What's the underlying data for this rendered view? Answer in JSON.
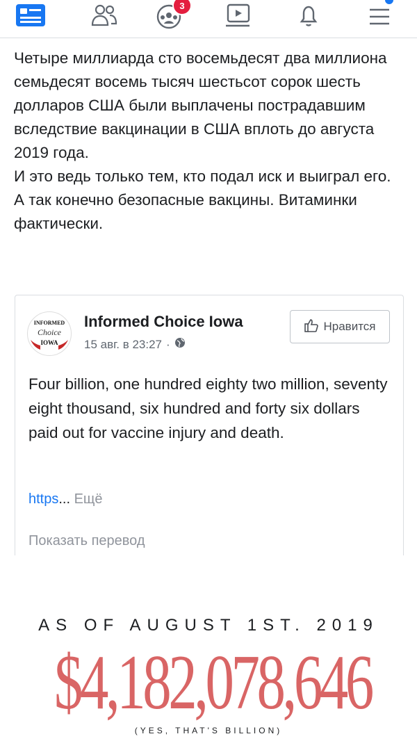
{
  "nav": {
    "friends_badge": "3"
  },
  "post": {
    "paragraphs": [
      "Четыре миллиарда сто восемьдесят два миллиона семьдесят восемь тысяч шестьсот сорок шесть долларов США были выплачены пострадавшим вследствие вакцинации в США вплоть до августа 2019 года.",
      "И это ведь только тем, кто подал иск и выиграл его.",
      "А так конечно безопасные вакцины. Витаминки фактически."
    ]
  },
  "shared": {
    "page_name": "Informed Choice Iowa",
    "avatar_text": [
      "INFORMED",
      "Choice",
      "IOWA"
    ],
    "date": "15 авг. в 23:27",
    "dot": "·",
    "like_label": "Нравится",
    "text": "Four billion, one hundred eighty two million, seventy eight thousand, six hundred and forty six dollars paid out for vaccine injury and death.",
    "link": "https",
    "ellipsis": "...",
    "more_label": "Ещё",
    "translate_label": "Показать перевод"
  },
  "graphic": {
    "as_of": "AS OF AUGUST 1ST. 2019",
    "amount": "$4,182,078,646",
    "note": "(YES, THAT'S BILLION)"
  },
  "colors": {
    "accent": "#1877f2",
    "badge": "#e41e3f",
    "amount": "#d96565"
  }
}
